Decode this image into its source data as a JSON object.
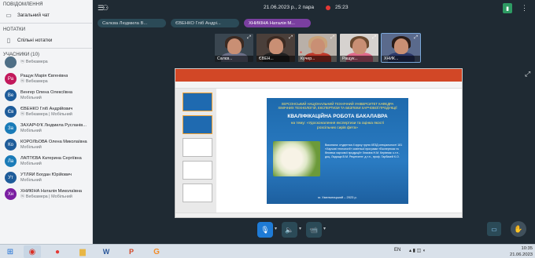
{
  "sidebar": {
    "sections": {
      "messages": "ПОВІДОМЛЕННЯ",
      "notes": "НОТАТКИ",
      "participants": "УЧАСНИКИ (10)"
    },
    "public_chat": "Загальний чат",
    "shared_notes": "Спільні нотатки",
    "participants": [
      {
        "initials": "",
        "name": "",
        "sub": "ⓦ Вебкамера",
        "color": "#4f6f86"
      },
      {
        "initials": "Ра",
        "name": "Ращук Марія Євгенівна",
        "sub": "ⓦ Вебкамера",
        "color": "#c2185b"
      },
      {
        "initials": "Ве",
        "name": "Венгер Олена Олексіївна",
        "sub": "Мобільний",
        "color": "#1e5c9a"
      },
      {
        "initials": "Єв",
        "name": "ЄВЕНКО Гліб Андрійович",
        "sub": "ⓦ Вебкамера | Мобільний",
        "color": "#1e5c9a"
      },
      {
        "initials": "За",
        "name": "ЗАХАРЧУК Людмила Русланів...",
        "sub": "Мобільний",
        "color": "#1a7bb8"
      },
      {
        "initials": "Ко",
        "name": "КОРОЛЬОВА Олена Миколаївна",
        "sub": "Мобільний",
        "color": "#1e5c9a"
      },
      {
        "initials": "Ла",
        "name": "ЛАПТЄВА Катерина Сергіївна",
        "sub": "Мобільний",
        "color": "#1a7bb8"
      },
      {
        "initials": "Ут",
        "name": "УТЛЯЙ Богдан Юрійович",
        "sub": "Мобільний",
        "color": "#1e5c9a"
      },
      {
        "initials": "Хн",
        "name": "ХНИКІНА Наталія Миколаївна",
        "sub": "ⓦ Вебкамера | Мобільний",
        "color": "#7b1fa2"
      }
    ]
  },
  "topbar": {
    "datetime": "21.06.2023 р., 2 пара",
    "timer": "25:23"
  },
  "chips": [
    "Салєва Людмила В...",
    "ЄВЕНКО Гліб Андрі...",
    "ХНИКІНА Наталія М..."
  ],
  "thumbnails": [
    "Салєв...",
    "ЄВЕН...",
    "Кучер...",
    "Ращук...",
    "ХНИК..."
  ],
  "slide": {
    "header": "ХЕРСОНСЬКИЙ НАЦІОНАЛЬНИЙ ТЕХНІЧНИЙ УНІВЕРСИТЕТ КАФЕДРА ХІМІЧНИХ ТЕХНОЛОГІЙ, ЕКСПЕРТИЗИ ТА БЕЗПЕКИ ХАРЧОВОЇ ПРОДУКЦІЇ",
    "title": "КВАЛІФІКАЦІЙНА РОБОТА БАКАЛАВРА",
    "subtitle": "на тему: «Удосконалення експертизи та оцінка якості розсільних сирів фета»",
    "info": "Виконала: студентка 4 курсу групи 4ЕЗД спеціальності 181 «Харчові технології» освітньої програми «Експертиза та безпека харчової продукції» Хникіна Н.М. Керівник: к.т.н., доц. Ладоща В.М. Рецензент: д.т.н., проф. Гарбазей К.О.",
    "footer": "м. Хмельницький – 2023 р."
  },
  "taskbar": {
    "lang": "EN",
    "time": "10:35",
    "date": "21.06.2023"
  },
  "colors": {
    "accent": "#7a3fa0",
    "record": "#e53935",
    "control": "#2b4a57"
  }
}
